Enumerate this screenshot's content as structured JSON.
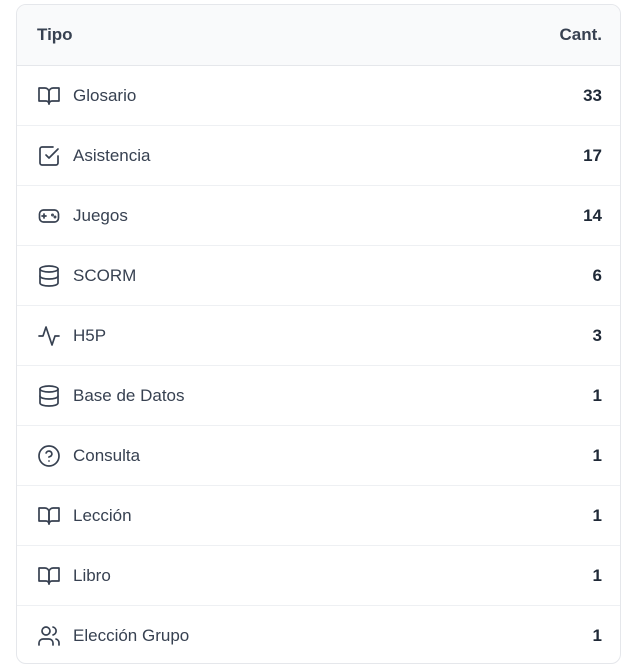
{
  "table": {
    "header": {
      "type_label": "Tipo",
      "count_label": "Cant."
    },
    "rows": [
      {
        "icon": "book-icon",
        "label": "Glosario",
        "count": "33"
      },
      {
        "icon": "check-square-icon",
        "label": "Asistencia",
        "count": "17"
      },
      {
        "icon": "gamepad-icon",
        "label": "Juegos",
        "count": "14"
      },
      {
        "icon": "database-icon",
        "label": "SCORM",
        "count": "6"
      },
      {
        "icon": "activity-icon",
        "label": "H5P",
        "count": "3"
      },
      {
        "icon": "database-icon",
        "label": "Base de Datos",
        "count": "1"
      },
      {
        "icon": "help-circle-icon",
        "label": "Consulta",
        "count": "1"
      },
      {
        "icon": "book-icon",
        "label": "Lección",
        "count": "1"
      },
      {
        "icon": "book-icon",
        "label": "Libro",
        "count": "1"
      },
      {
        "icon": "users-icon",
        "label": "Elección Grupo",
        "count": "1"
      }
    ]
  }
}
